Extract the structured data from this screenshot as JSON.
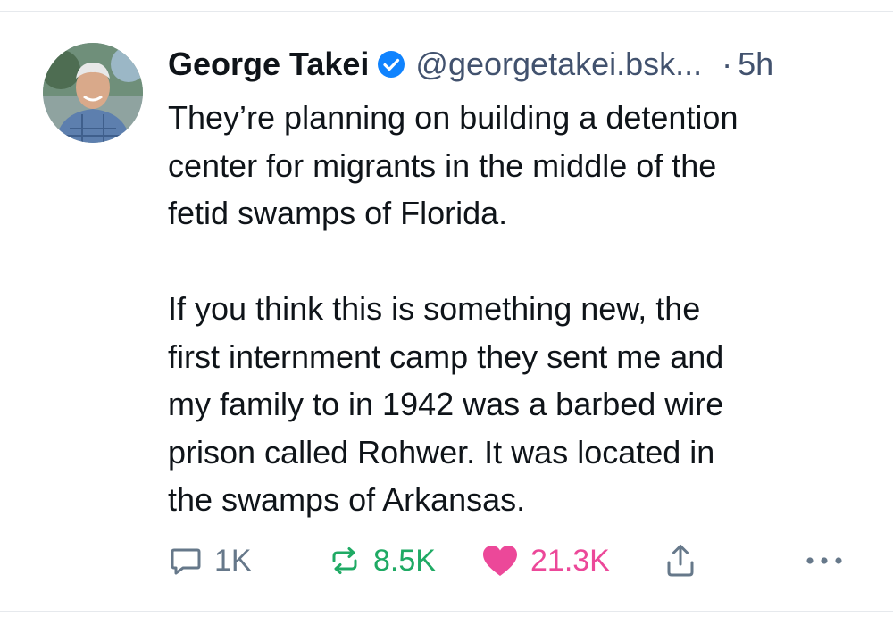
{
  "post": {
    "author": {
      "display_name": "George Takei",
      "handle": "@georgetakei.bsk...",
      "verified": true
    },
    "separator": "·",
    "time": "5h",
    "paragraphs": [
      [
        "They’re planning on building a detention",
        "center for migrants in the middle of the",
        "fetid swamps of Florida."
      ],
      [
        "If you think this is something new, the",
        "first internment camp they sent me and",
        "my family to in 1942 was a barbed wire",
        "prison called Rohwer. It was located in",
        "the swamps of Arkansas."
      ]
    ],
    "actions": {
      "reply_count": "1K",
      "repost_count": "8.5K",
      "like_count": "21.3K"
    }
  },
  "icons": {
    "verified": "verified-check-icon",
    "reply": "reply-bubble-icon",
    "repost": "repost-icon",
    "like": "heart-icon",
    "share": "share-icon",
    "more": "more-dots-icon"
  },
  "colors": {
    "verified": "#1083fe",
    "reply": "#66788a",
    "repost": "#1faa64",
    "like": "#ec4899",
    "text": "#0f1419",
    "secondary": "#42526e"
  }
}
